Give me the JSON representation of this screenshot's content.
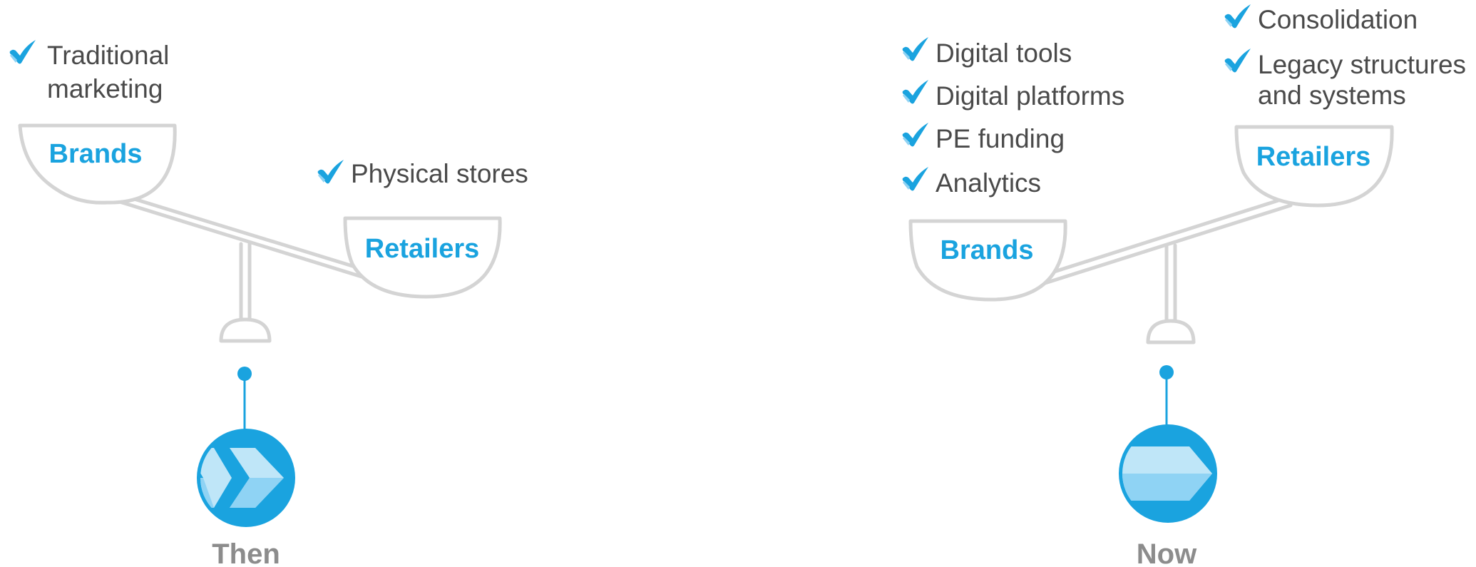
{
  "colors": {
    "accent": "#1aa3df",
    "scale_outline": "#d4d4d4",
    "text": "#4a4a4a",
    "caption": "#8c8c8c",
    "icon_light": "#bfe6f8",
    "icon_mid": "#8fd3f4"
  },
  "then_panel": {
    "brands_items": [
      {
        "icon": "checkmark-icon",
        "lines": [
          "Traditional",
          "marketing"
        ]
      }
    ],
    "retailers_items": [
      {
        "icon": "checkmark-icon",
        "lines": [
          "Physical stores"
        ]
      }
    ],
    "brands_label": "Brands",
    "retailers_label": "Retailers",
    "tilt": "retailers-heavier",
    "caption": "Then",
    "badge_icon": "double-chevron-icon"
  },
  "now_panel": {
    "brands_items": [
      {
        "icon": "checkmark-icon",
        "lines": [
          "Digital tools"
        ]
      },
      {
        "icon": "checkmark-icon",
        "lines": [
          "Digital platforms"
        ]
      },
      {
        "icon": "checkmark-icon",
        "lines": [
          "PE funding"
        ]
      },
      {
        "icon": "checkmark-icon",
        "lines": [
          "Analytics"
        ]
      }
    ],
    "retailers_items": [
      {
        "icon": "checkmark-icon",
        "lines": [
          "Consolidation"
        ]
      },
      {
        "icon": "checkmark-icon",
        "lines": [
          "Legacy structures",
          "and systems"
        ]
      }
    ],
    "brands_label": "Brands",
    "retailers_label": "Retailers",
    "tilt": "brands-heavier",
    "caption": "Now",
    "badge_icon": "arrow-right-icon"
  }
}
